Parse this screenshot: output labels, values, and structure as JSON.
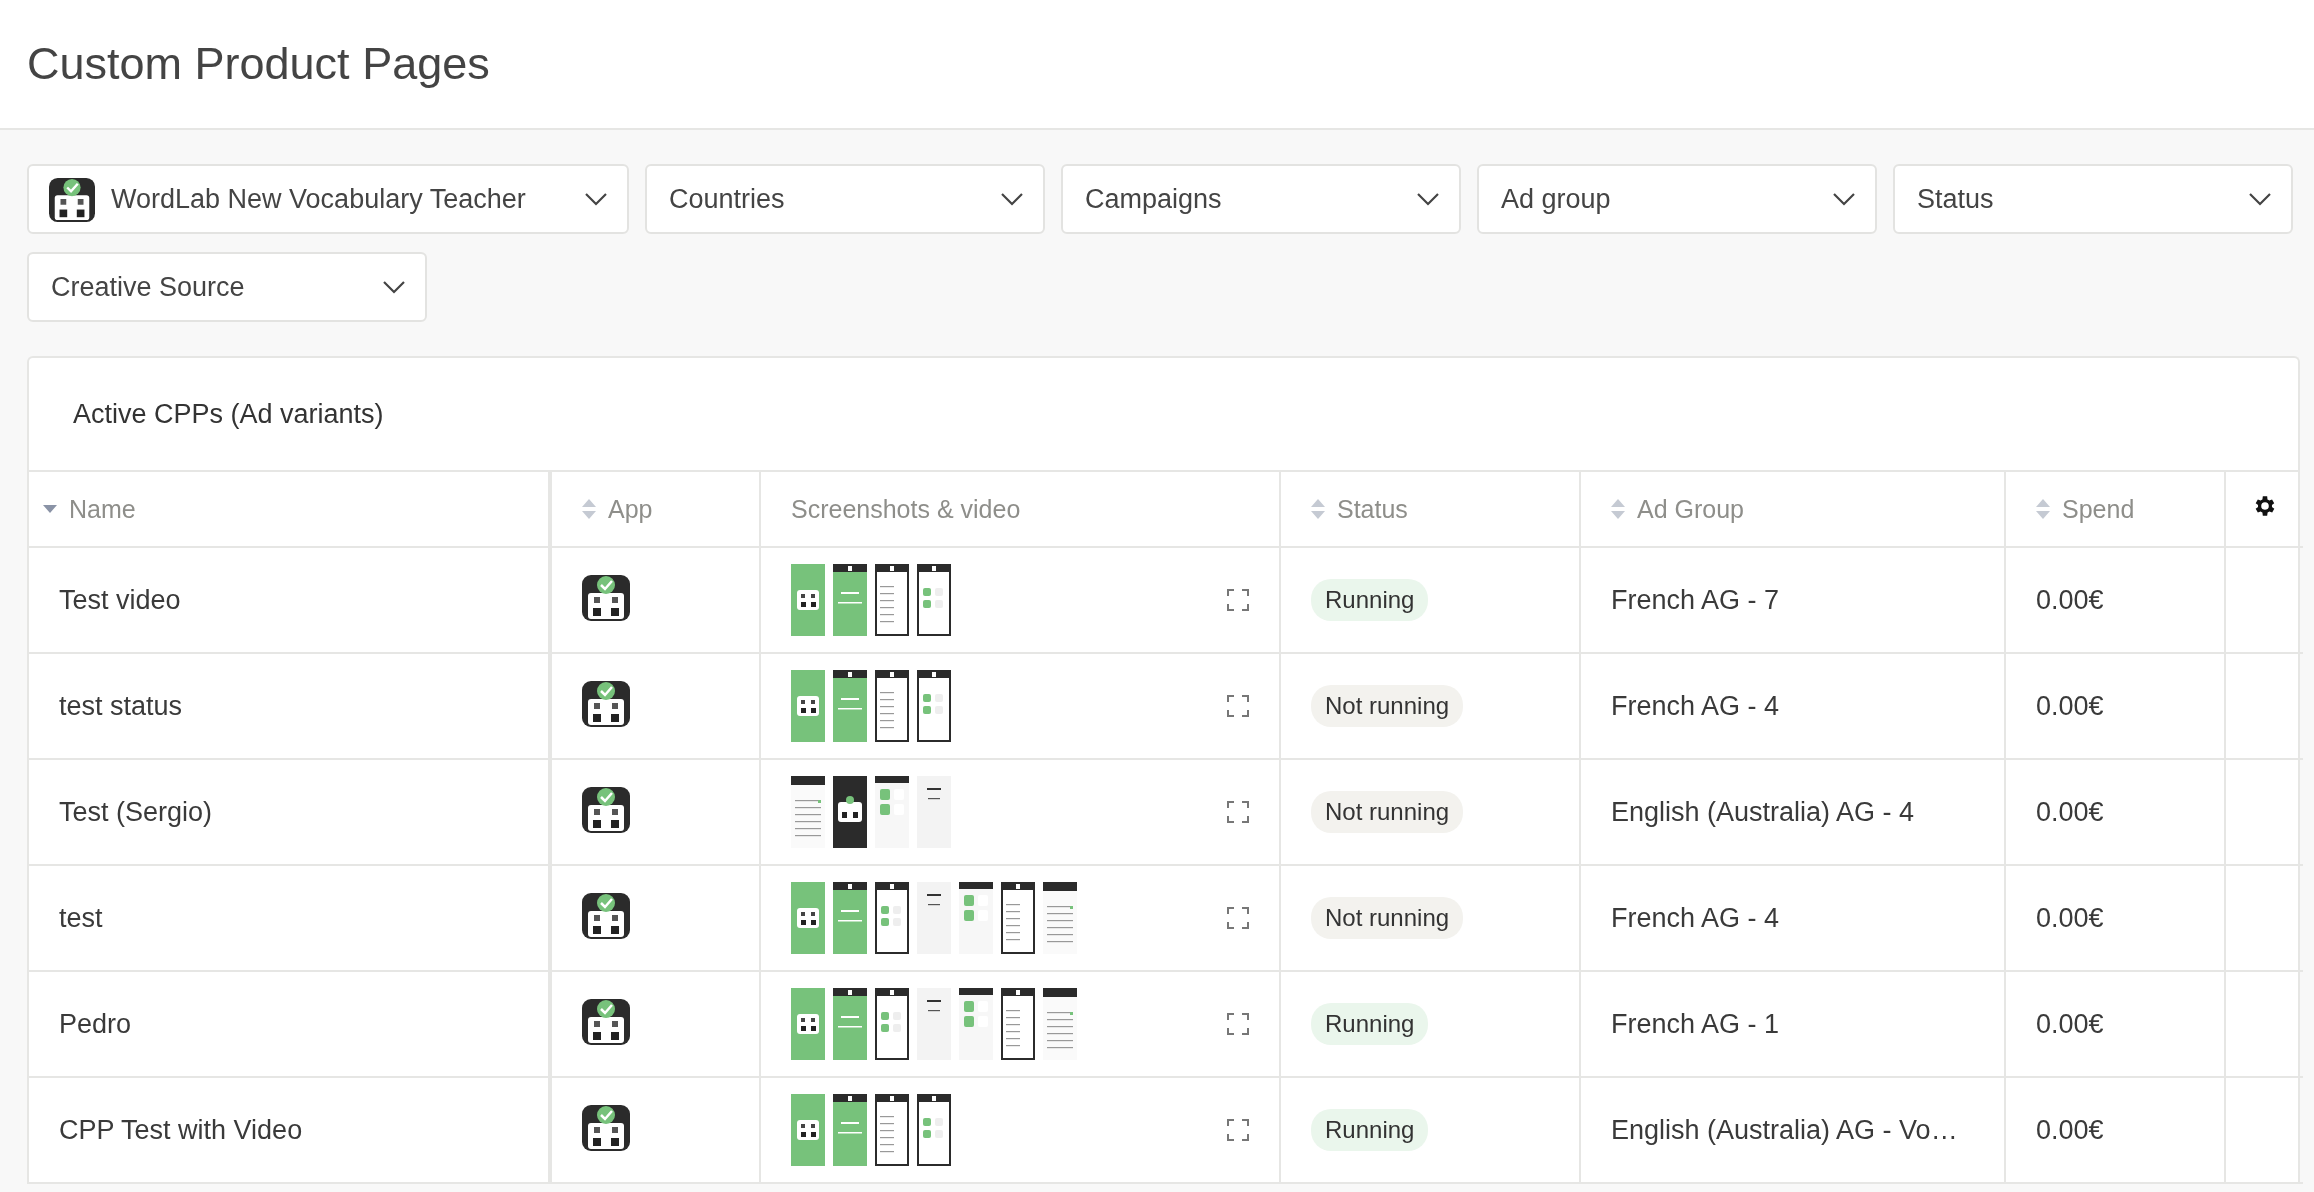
{
  "page": {
    "title": "Custom Product Pages"
  },
  "filters": [
    {
      "label": "WordLab New Vocabulary Teacher",
      "kind": "app"
    },
    {
      "label": "Countries",
      "kind": "plain"
    },
    {
      "label": "Campaigns",
      "kind": "plain"
    },
    {
      "label": "Ad group",
      "kind": "plain"
    },
    {
      "label": "Status",
      "kind": "plain"
    },
    {
      "label": "Creative Source",
      "kind": "plain"
    }
  ],
  "card": {
    "title": "Active CPPs (Ad variants)"
  },
  "table": {
    "columns": [
      {
        "label": "Name",
        "kind": "descending"
      },
      {
        "label": "App",
        "kind": "sortable"
      },
      {
        "label": "Screenshots & video",
        "kind": "plain"
      },
      {
        "label": "Status",
        "kind": "sortable"
      },
      {
        "label": "Ad Group",
        "kind": "sortable"
      },
      {
        "label": "Spend",
        "kind": "sortable"
      }
    ],
    "rows": [
      {
        "name": "Test video",
        "screens": [
          {
            "kind": "logo-green"
          },
          {
            "kind": "splash-green"
          },
          {
            "kind": "list-framed"
          },
          {
            "kind": "grid-framed"
          }
        ],
        "status": {
          "label": "Running",
          "kind": "running"
        },
        "ad_group": "French AG - 7",
        "spend": "0.00€"
      },
      {
        "name": "test status",
        "screens": [
          {
            "kind": "logo-green"
          },
          {
            "kind": "splash-green"
          },
          {
            "kind": "list-framed"
          },
          {
            "kind": "grid-framed"
          }
        ],
        "status": {
          "label": "Not running",
          "kind": "stopped"
        },
        "ad_group": "French AG - 4",
        "spend": "0.00€"
      },
      {
        "name": "Test (Sergio)",
        "screens": [
          {
            "kind": "list-plain"
          },
          {
            "kind": "logo-dark"
          },
          {
            "kind": "grid-plain"
          },
          {
            "kind": "text-plain"
          }
        ],
        "status": {
          "label": "Not running",
          "kind": "stopped"
        },
        "ad_group": "English (Australia) AG - 4",
        "spend": "0.00€"
      },
      {
        "name": "test",
        "screens": [
          {
            "kind": "logo-green"
          },
          {
            "kind": "splash-green"
          },
          {
            "kind": "grid-framed"
          },
          {
            "kind": "text-plain"
          },
          {
            "kind": "grid-plain"
          },
          {
            "kind": "list-framed"
          },
          {
            "kind": "list-plain"
          }
        ],
        "status": {
          "label": "Not running",
          "kind": "stopped"
        },
        "ad_group": "French AG - 4",
        "spend": "0.00€"
      },
      {
        "name": "Pedro",
        "screens": [
          {
            "kind": "logo-green"
          },
          {
            "kind": "splash-green"
          },
          {
            "kind": "grid-framed"
          },
          {
            "kind": "text-plain"
          },
          {
            "kind": "grid-plain"
          },
          {
            "kind": "list-framed"
          },
          {
            "kind": "list-plain"
          }
        ],
        "status": {
          "label": "Running",
          "kind": "running"
        },
        "ad_group": "French AG - 1",
        "spend": "0.00€"
      },
      {
        "name": "CPP Test with Video",
        "screens": [
          {
            "kind": "logo-green"
          },
          {
            "kind": "splash-green"
          },
          {
            "kind": "list-framed"
          },
          {
            "kind": "grid-framed"
          }
        ],
        "status": {
          "label": "Running",
          "kind": "running"
        },
        "ad_group": "English (Australia) AG - Vo…",
        "spend": "0.00€"
      }
    ]
  }
}
